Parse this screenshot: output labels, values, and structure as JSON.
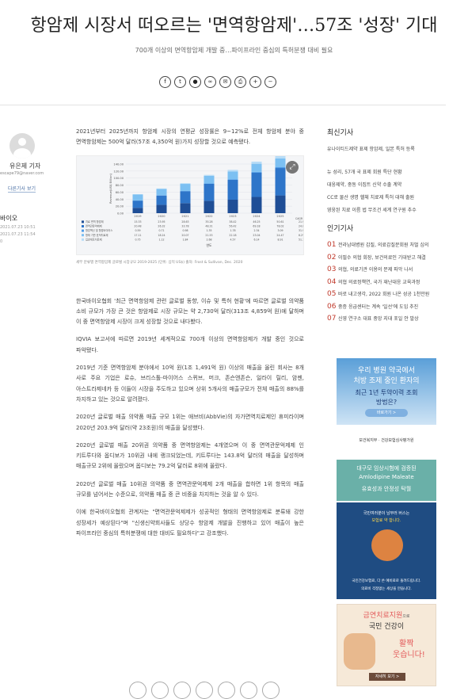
{
  "headline": "항암제 시장서 떠오르는 '면역항암제'…57조 '성장' 기대",
  "subhead": "700개 이상의 면역항암제 개발 중…파이프라인 중심의 특허분쟁 대비 필요",
  "share_icons": [
    "facebook-icon",
    "twitter-icon",
    "kakao-icon",
    "link-icon",
    "email-icon",
    "print-icon",
    "font-up-icon",
    "font-down-icon"
  ],
  "author": {
    "name": "유은제 기자",
    "email": "escape79@naver.com",
    "more_label": "다른기사 보기",
    "section": "바이오",
    "dates": [
      "2021.07.23 10:51",
      "2021.07.23 11:54"
    ],
    "count": "0"
  },
  "article": {
    "intro": "2021년부터 2025년까지 항암제 시장의 연평균 성장률은 9~12%로 전체 항암제 분야 중 면역항암제는 500억 달러(57조 4,350억 원)가지 성장할 것으로 예측됐다.",
    "caption": "세부 분류별 면역항암제 글로벌 시장규모 2019-2025 (단위: 십억 US$) 출처: Frost & Sullivan, Dec. 2020",
    "paragraphs": [
      "한국바이오협회 '최근 면역항암제 관련 글로벌 동향, 이슈 및 특허 현황'에 따르면 글로벌 의약품 소비 규모가 가장 큰 것은 항암제로 시장 규모는 약 2,730억 달러(313조 4,859억 원)에 달하며 이 중 면역항암제 시장이 크게 성장할 것으로 내다봤다.",
      "IQVIA 보고서에 따르면 2019년 세계적으로 700개 이상의 면역항암제가 개발 중인 것으로 파악됐다.",
      "2019년 기준 면역항암제 분야에서 10억 원(1조 1,491억 원) 이상의 매출을 올린 회사는 8개 사로 주요 기업은 로슈, 브리스톨-마이어스 스퀴브, 머크, 존슨앤존슨, 일라이 릴리, 암젠, 아스트라제네카 등 이들이 시장을 주도하고 있으며 상위 5개사의 매출규모가 전체 매출의 88%를 차지하고 있는 것으로 알려졌다.",
      "2020년 글로벌 매출 의약품 매출 규모 1위는 애브비(AbbVie)의 자가면역치료제인 휴미라이며 2020년 203.9억 달러(약 23조원)의 매출을 달성했다.",
      "2020년 글로벌 매출 20위권 의약품 중 면역항암제는 4개였으며 이 중 면역관문억제제 인 키트루다와 옵디보가 10위권 내에 랭크되었는데, 키트루다는 143.8억 달러의 매출을 달성하며 매출규모 2위에 올랐으며 옵디보는 79.2억 달러로 8위에 올랐다.",
      "2020년 글로벌 매출 10위권 의약품 중 면역관문억제제 2개 매출을 합하면 1위 항목의 매출 규모를 넘어서는 수준으로, 의약품 매출 중 큰 비중을 차지하는 것을 알 수 있다.",
      "이에 한국바이오협회 관계자는 \"면역관문억제제가 성공적인 형태의 면역항암제로 분류돼 강한 성장세가 예상된다\"며 \"신생신약회사들도 상당수 항암제 개발을 진행하고 있어 매출이 높은 파이프라인 중심의 특허분쟁에 대한 대비도 필요하다\"고 강조했다."
    ]
  },
  "chart_data": {
    "type": "bar",
    "categories": [
      "2019",
      "2020",
      "2021",
      "2022",
      "2023",
      "2024",
      "2025"
    ],
    "ylabel": "Revenue(US$ Billion)",
    "xlabel": "연도",
    "ylim": [
      0,
      140
    ],
    "yticks": [
      "0.00",
      "20.00",
      "40.00",
      "60.00",
      "80.00",
      "100.00",
      "120.00",
      "140.00"
    ],
    "legend_header": "CAGR (19~25)",
    "series": [
      {
        "name": "치료 면역 항암제",
        "values": [
          15.33,
          23.95,
          28.63,
          35.28,
          38.42,
          46.25,
          50.61
        ],
        "cagr": "21.9%"
      },
      {
        "name": "면역관문억제제",
        "values": [
          20.48,
          26.32,
          33.78,
          48.31,
          56.42,
          69.18,
          78.02
        ],
        "cagr": "24.0%"
      },
      {
        "name": "항암백신 및 항암바이러스",
        "values": [
          0.59,
          0.71,
          0.98,
          1.35,
          1.78,
          2.34,
          3.09
        ],
        "cagr": "31.9%"
      },
      {
        "name": "항체 기반 표적치료제",
        "values": [
          17.11,
          18.24,
          20.07,
          21.53,
          22.18,
          23.04,
          24.47
        ],
        "cagr": "6.2%"
      },
      {
        "name": "입양세포치료제",
        "values": [
          0.75,
          1.12,
          1.84,
          2.68,
          4.57,
          6.14,
          8.91
        ],
        "cagr": "51.1%"
      }
    ]
  },
  "sidebar": {
    "latest_title": "최신기사",
    "latest_items": [
      "유나이티드제약 표제 항암제, 일본 특허 등록",
      "뉴 성리, 57개 국 표제 회원 특단 현황",
      "대웅제약, 중동 이집트 신약 수출 계약",
      "CC로 물산 생명 헬체 치료제 특허 대해 출원",
      "영웅된 치료 이름 법 무조건 세계 연구원 추수"
    ],
    "popular_title": "인기기사",
    "popular_items": [
      {
        "num": "01",
        "text": "전라남대병원 갑질, 의료갑질문회원 처벌 심의"
      },
      {
        "num": "02",
        "text": "이필수 의협 회장, 보건의료인 기대받고 해결"
      },
      {
        "num": "03",
        "text": "의협, 의료기관 이용의 문제 파악 나서"
      },
      {
        "num": "04",
        "text": "의협 의료정책연, 국가 재난대응 교육과정"
      },
      {
        "num": "05",
        "text": "바로 내고생각, 2022 회원 나온 성공 1천만원"
      },
      {
        "num": "06",
        "text": "중증 응급센터는 계속 '일선'에 도입 추진"
      },
      {
        "num": "07",
        "text": "신영 연구소 대표 중앙 지대 포일 안 발상"
      }
    ]
  },
  "ads": {
    "ad1": {
      "line1": "우리 병원 약국에서",
      "line2": "처방 조제 중인 환자의",
      "line3": "최근 1년 투약이력 조회",
      "line4": "방법은?",
      "button": "바로가기 >",
      "org1": "보건복지부",
      "org2": "건강보험심사평가원"
    },
    "ad2": {
      "line1": "대구모 임상시험에 검증된",
      "line2": "Amlodipine Maleate",
      "line3": "유효성과 안정성 탁월"
    },
    "ad3": {
      "line1": "국민여러분이 남부러 버스는",
      "line2": "보험료 약 합니다.",
      "line3": "국민건강보험료, 다 쓴 예비료로 돌려드립니다.",
      "line4": "의료비 걱정없는 세상을 만듭니다."
    },
    "ad4": {
      "line1": "금연치료지원",
      "line1b": "으로",
      "line2": "국민 건강이",
      "line3": "활짝",
      "line4": "웃습니다!",
      "button": "자세히 보기 >"
    }
  }
}
